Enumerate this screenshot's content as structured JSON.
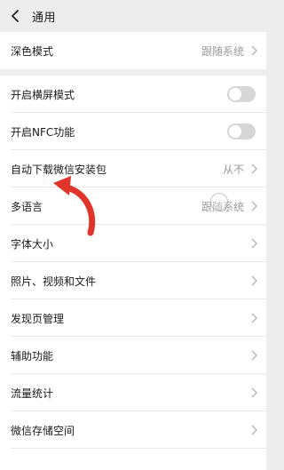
{
  "header": {
    "title": "通用",
    "back_icon": "chevron-left-icon"
  },
  "rows": [
    {
      "label": "深色模式",
      "value": "跟随系统",
      "type": "link"
    },
    {
      "label": "开启横屏模式",
      "type": "toggle",
      "on": false
    },
    {
      "label": "开启NFC功能",
      "type": "toggle",
      "on": false
    },
    {
      "label": "自动下载微信安装包",
      "value": "从不",
      "type": "link"
    },
    {
      "label": "多语言",
      "value": "跟随系统",
      "type": "link"
    },
    {
      "label": "字体大小",
      "type": "link"
    },
    {
      "label": "照片、视频和文件",
      "type": "link"
    },
    {
      "label": "发现页管理",
      "type": "link"
    },
    {
      "label": "辅助功能",
      "type": "link"
    },
    {
      "label": "流量统计",
      "type": "link"
    },
    {
      "label": "微信存储空间",
      "type": "link"
    }
  ],
  "annotation": {
    "arrow_color": "#e0352b",
    "icon": "curved-arrow-icon"
  }
}
